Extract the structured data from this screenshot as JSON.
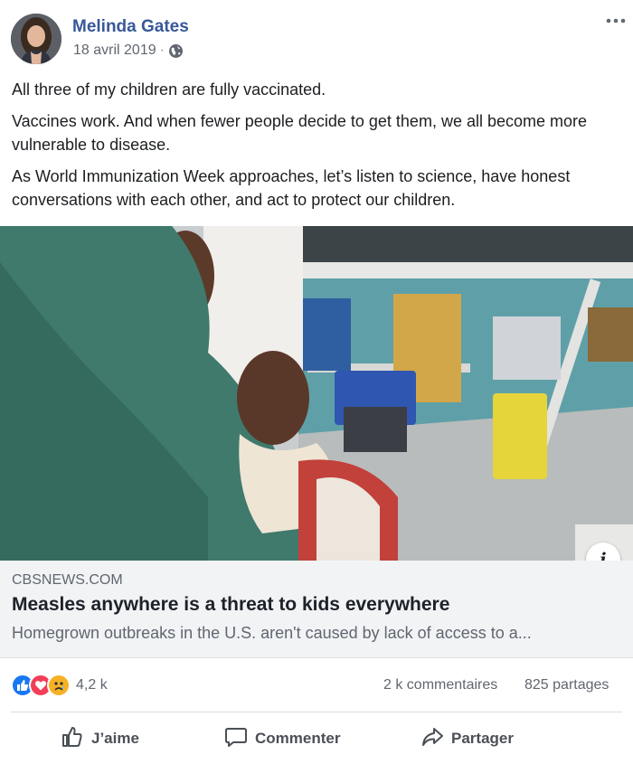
{
  "post": {
    "author": "Melinda Gates",
    "date": "18 avril 2019",
    "separator": "·",
    "privacy_icon": "globe-icon",
    "more_icon": "more-options-icon",
    "paragraphs": [
      "All three of my children are fully vaccinated.",
      "Vaccines work. And when fewer people decide to get them, we all become more vulnerable to disease.",
      "As World Immunization Week approaches, let’s listen to science, have honest conversations with each other, and act to protect our children."
    ]
  },
  "link": {
    "domain": "CBSNEWS.COM",
    "title": "Measles anywhere is a threat to kids everywhere",
    "description": "Homegrown outbreaks in the U.S. aren't caused by lack of access to a...",
    "info_label": "i"
  },
  "stats": {
    "reaction_icons": [
      "like-icon",
      "love-icon",
      "sad-icon"
    ],
    "reactions_count": "4,2 k",
    "comments": "2 k commentaires",
    "shares": "825 partages"
  },
  "actions": {
    "like": "J’aime",
    "comment": "Commenter",
    "share": "Partager"
  },
  "colors": {
    "author_link": "#385898",
    "like_blue": "#1877f2",
    "love_red": "#f33e58",
    "sad_yellow": "#f7b125",
    "card_bg": "#f2f3f5"
  }
}
